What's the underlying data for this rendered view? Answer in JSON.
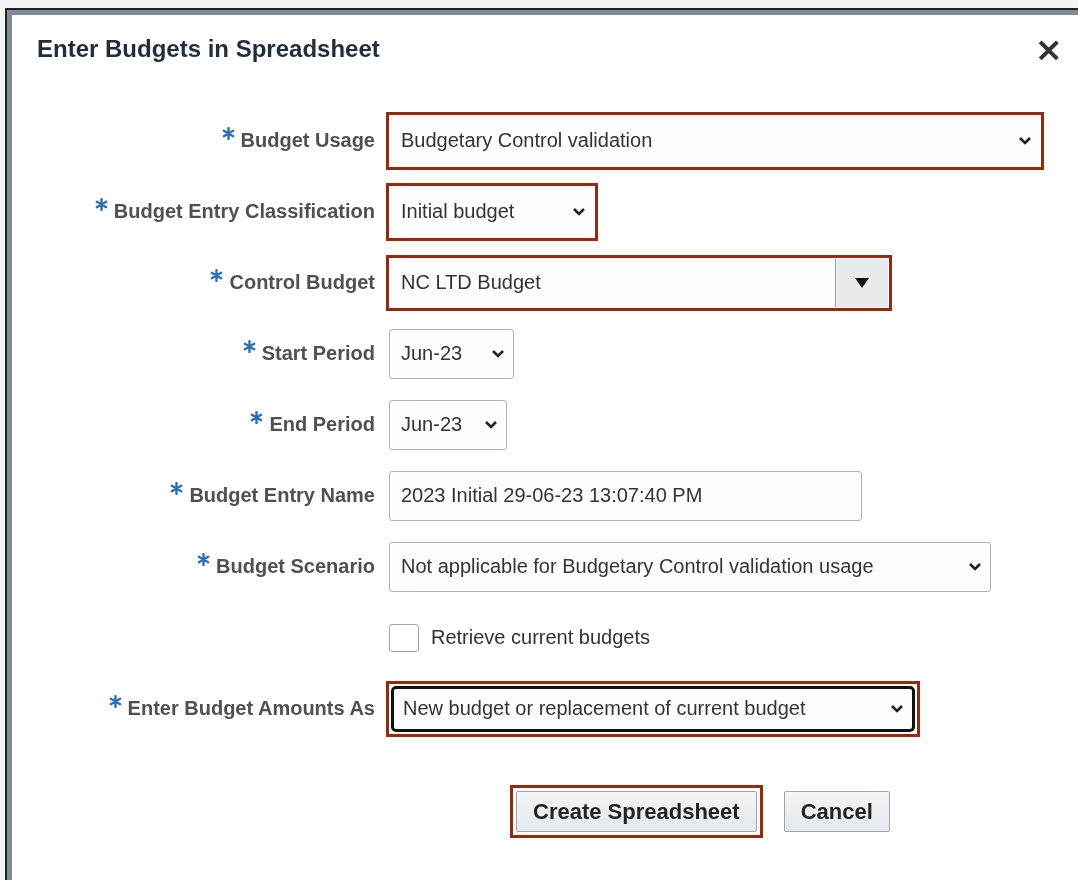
{
  "dialog": {
    "title": "Enter Budgets in Spreadsheet",
    "close": "×"
  },
  "fields": [
    {
      "kind": "select",
      "label": "Budget Usage",
      "required": true,
      "value": "Budgetary Control validation",
      "highlighted": true,
      "focused": false
    },
    {
      "kind": "select",
      "label": "Budget Entry Classification",
      "required": true,
      "value": "Initial budget",
      "highlighted": true,
      "focused": false
    },
    {
      "kind": "combo",
      "label": "Control Budget",
      "required": true,
      "value": "NC LTD Budget",
      "highlighted": true,
      "focused": false
    },
    {
      "kind": "select",
      "label": "Start Period",
      "required": true,
      "value": "Jun-23",
      "highlighted": false,
      "focused": false
    },
    {
      "kind": "select",
      "label": "End Period",
      "required": true,
      "value": "Jun-23",
      "highlighted": false,
      "focused": false
    },
    {
      "kind": "text",
      "label": "Budget Entry Name",
      "required": true,
      "value": "2023 Initial 29-06-23 13:07:40 PM",
      "highlighted": false,
      "focused": false
    },
    {
      "kind": "select",
      "label": "Budget Scenario",
      "required": true,
      "value": "Not applicable for Budgetary Control validation usage",
      "highlighted": false,
      "focused": false
    },
    {
      "kind": "checkbox",
      "label": "Retrieve current budgets",
      "checked": false
    },
    {
      "kind": "select",
      "label": "Enter Budget Amounts As",
      "required": true,
      "value": "New budget or replacement of current budget",
      "highlighted": true,
      "focused": true
    }
  ],
  "buttons": [
    {
      "label": "Create Spreadsheet",
      "highlighted": true
    },
    {
      "label": "Cancel",
      "highlighted": false
    }
  ]
}
